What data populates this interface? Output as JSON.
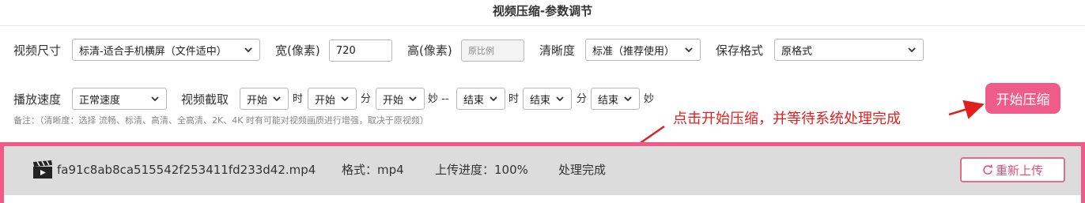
{
  "title": "视频压缩-参数调节",
  "row1": {
    "size_label": "视频尺寸",
    "size_value": "标清-适合手机横屏（文件适中）",
    "width_label": "宽(像素)",
    "width_value": "720",
    "height_label": "高(像素)",
    "height_placeholder": "原比例",
    "clarity_label": "清晰度",
    "clarity_value": "标准（推荐使用）",
    "format_label": "保存格式",
    "format_value": "原格式"
  },
  "row2": {
    "speed_label": "播放速度",
    "speed_value": "正常速度",
    "clip_label": "视频截取",
    "start_hour": "开始",
    "hour_unit": "时",
    "start_min": "开始",
    "min_unit": "分",
    "start_sec": "开始",
    "sec_unit": "妙 --",
    "end_hour": "结束",
    "end_hour_unit": "时",
    "end_min": "结束",
    "end_min_unit": "分",
    "end_sec": "结束",
    "end_sec_unit": "妙"
  },
  "note": "备注：（清晰度：选择 流畅、标清、高清、全高清、2K、4K 时有可能对视频画质进行增强，取决于原视频）",
  "start_button": "开始压缩",
  "annotation": "点击开始压缩，并等待系统处理完成",
  "file": {
    "icon": "clapperboard-icon",
    "name": "fa91c8ab8ca515542f253411fd233d42.mp4",
    "format": "格式：mp4",
    "progress": "上传进度：100%",
    "status": "处理完成",
    "reupload_label": "重新上传",
    "reupload_icon": "refresh-icon"
  },
  "colors": {
    "accent": "#f05c8a",
    "annotation": "#e02020"
  }
}
